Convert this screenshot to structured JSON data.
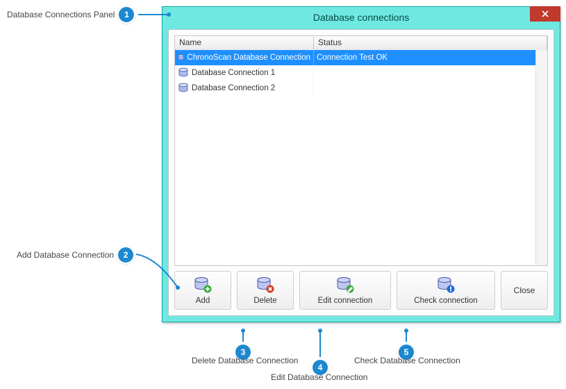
{
  "window_title": "Database connections",
  "columns": {
    "name": "Name",
    "status": "Status"
  },
  "rows": [
    {
      "name": "ChronoScan Database Connection",
      "status": "Connection Test OK",
      "selected": true
    },
    {
      "name": "Database Connection 1",
      "status": "",
      "selected": false
    },
    {
      "name": "Database Connection 2",
      "status": "",
      "selected": false
    }
  ],
  "buttons": {
    "add": "Add",
    "delete": "Delete",
    "edit": "Edit connection",
    "check": "Check connection",
    "close": "Close"
  },
  "annotations": {
    "1": "Database Connections Panel",
    "2": "Add Database Connection",
    "3": "Delete Database Connection",
    "4": "Edit Database Connection",
    "5": "Check Database Connection"
  }
}
